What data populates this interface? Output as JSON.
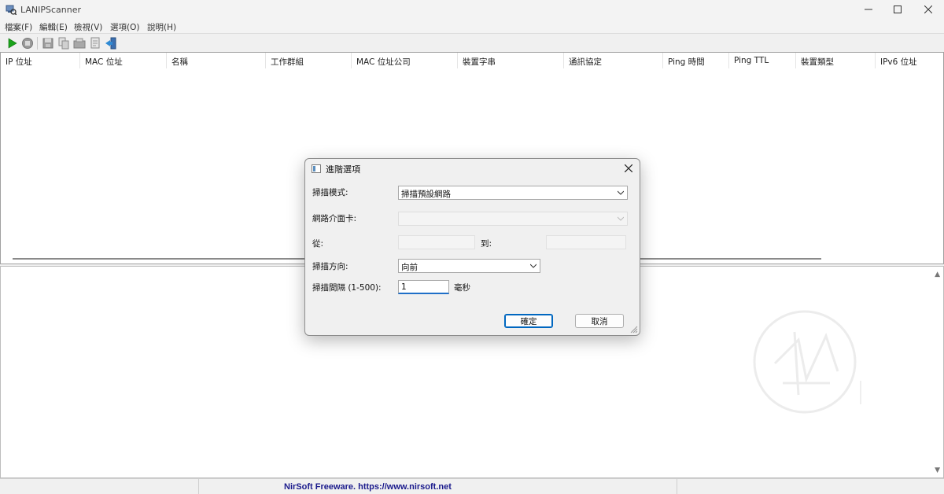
{
  "window": {
    "title": "LANIPScanner"
  },
  "menu": [
    "檔案(F)",
    "編輯(E)",
    "檢視(V)",
    "選項(O)",
    "說明(H)"
  ],
  "columns": [
    "IP 位址",
    "MAC 位址",
    "名稱",
    "工作群組",
    "MAC 位址公司",
    "裝置字串",
    "通訊協定",
    "Ping 時間",
    "Ping TTL",
    "裝置類型",
    "IPv6 位址"
  ],
  "dialog": {
    "title": "進階選項",
    "scan_mode_label": "掃描模式:",
    "scan_mode_value": "掃描預設網路",
    "adapter_label": "網路介面卡:",
    "adapter_value": "",
    "from_label": "從:",
    "to_label": "到:",
    "direction_label": "掃描方向:",
    "direction_value": "向前",
    "interval_label": "掃描間隔 (1-500):",
    "interval_value": "1",
    "interval_unit": "毫秒",
    "ok_label": "確定",
    "cancel_label": "取消"
  },
  "status": {
    "link_text": "NirSoft Freeware. https://www.nirsoft.net"
  },
  "icons": {
    "play": "play-icon",
    "stop": "stop-icon",
    "save": "save-icon",
    "copy": "copy-icon",
    "properties": "properties-icon",
    "html-report": "html-report-icon",
    "exit": "exit-icon"
  },
  "colors": {
    "play_green": "#1aa31a",
    "status_link": "#1a1a8c",
    "default_button": "#0067c0"
  }
}
